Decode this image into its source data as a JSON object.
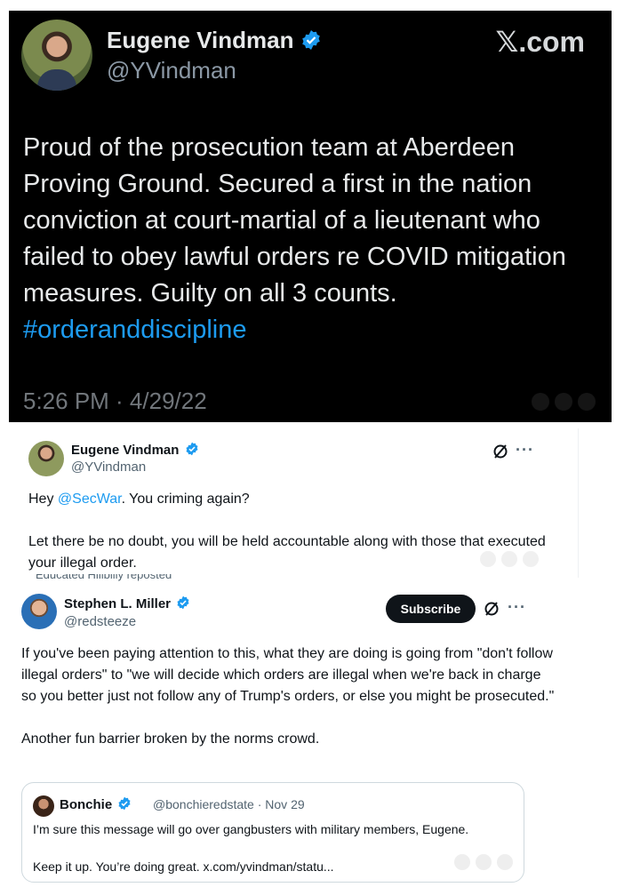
{
  "main_tweet": {
    "author_name": "Eugene Vindman",
    "author_handle": "@YVindman",
    "brand": "𝕏.com",
    "text": "Proud of the prosecution team at Aberdeen Proving Ground. Secured a first in the nation conviction at court-martial of a lieutenant who failed to obey lawful orders re COVID mitigation measures. Guilty on all 3 counts.",
    "hashtag": "#orderanddiscipline",
    "timestamp": "5:26 PM · 4/29/22"
  },
  "reply_tweet": {
    "author_name": "Eugene Vindman",
    "author_handle": "@YVindman",
    "text_prefix": "Hey ",
    "mention": "@SecWar",
    "text_suffix": ". You criming again?",
    "text_para2": "Let there be no doubt, you will be held accountable along with those that executed your illegal order.",
    "more_label": "···"
  },
  "miller_tweet": {
    "repost_text": "Educated Hillbilly  reposted",
    "author_name": "Stephen L. Miller",
    "author_handle": "@redsteeze",
    "subscribe_label": "Subscribe",
    "more_label": "···",
    "text": "If you've been paying attention to this, what they are doing is going from \"don't follow illegal orders\" to \"we will decide which orders are illegal when we're back in charge so you better just not follow any of Trump's orders, or else you might be prosecuted.\"\n\nAnother fun barrier broken by the norms crowd."
  },
  "quoted_tweet": {
    "author_name": "Bonchie",
    "handle_and_date": "@bonchieredstate · Nov 29",
    "text": "I’m sure this message will go over gangbusters with military members, Eugene.\n\nKeep it up. You’re doing great. x.com/yvindman/statu..."
  },
  "colors": {
    "accent": "#1d9bf0",
    "dark_bg": "#000000",
    "secondary_text": "#536471"
  }
}
